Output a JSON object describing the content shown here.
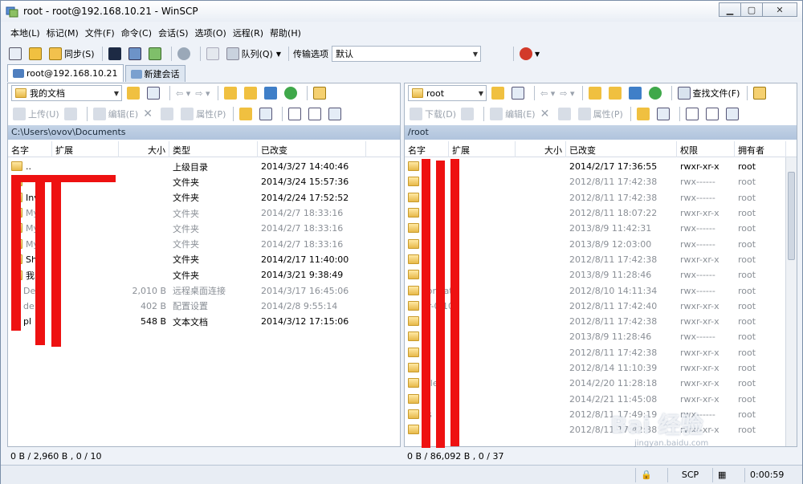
{
  "window": {
    "title": "root - root@192.168.10.21 - WinSCP",
    "buttons": {
      "min": "▁",
      "max": "▢",
      "close": "✕"
    }
  },
  "menu": [
    "本地(L)",
    "标记(M)",
    "文件(F)",
    "命令(C)",
    "会话(S)",
    "选项(O)",
    "远程(R)",
    "帮助(H)"
  ],
  "toolbar": {
    "sync_label": "同步(S)",
    "queue_label": "队列(Q)",
    "transfer_label": "传输选项",
    "transfer_value": "默认"
  },
  "tabs": [
    {
      "label": "root@192.168.10.21",
      "active": true
    },
    {
      "label": "新建会话",
      "active": false
    }
  ],
  "left": {
    "location": "我的文档",
    "actions": {
      "upload": "上传(U)",
      "edit": "编辑(E)",
      "props": "属性(P)"
    },
    "path": "C:\\Users\\ovov\\Documents",
    "columns": [
      "名字",
      "扩展",
      "大小",
      "类型",
      "已改变"
    ],
    "rows": [
      {
        "name": "..",
        "size": "",
        "type": "上级目录",
        "changed": "2014/3/27  14:40:46",
        "grey": false,
        "folder": true
      },
      {
        "name": "",
        "size": "",
        "type": "文件夹",
        "changed": "2014/3/24  15:57:36",
        "grey": false,
        "folder": true
      },
      {
        "name": "Inv",
        "size": "",
        "type": "文件夹",
        "changed": "2014/2/24  17:52:52",
        "grey": false,
        "folder": true
      },
      {
        "name": "My",
        "size": "",
        "type": "文件夹",
        "changed": "2014/2/7   18:33:16",
        "grey": true,
        "folder": true
      },
      {
        "name": "My",
        "size": "",
        "type": "文件夹",
        "changed": "2014/2/7   18:33:16",
        "grey": true,
        "folder": true
      },
      {
        "name": "My",
        "size": "",
        "type": "文件夹",
        "changed": "2014/2/7   18:33:16",
        "grey": true,
        "folder": true
      },
      {
        "name": "Shu",
        "size": "",
        "type": "文件夹",
        "changed": "2014/2/17  11:40:00",
        "grey": false,
        "folder": true
      },
      {
        "name": "我的",
        "size": "",
        "type": "文件夹",
        "changed": "2014/3/21   9:38:49",
        "grey": false,
        "folder": true
      },
      {
        "name": "De",
        "size": "2,010 B",
        "type": "远程桌面连接",
        "changed": "2014/3/17  16:45:06",
        "grey": true,
        "folder": false
      },
      {
        "name": "de",
        "size": "402 B",
        "type": "配置设置",
        "changed": "2014/2/8   9:55:14",
        "grey": true,
        "folder": false
      },
      {
        "name": "pl",
        "size": "548 B",
        "type": "文本文档",
        "changed": "2014/3/12  17:15:06",
        "grey": false,
        "folder": false
      }
    ],
    "status": "0 B / 2,960 B ,  0 / 10"
  },
  "right": {
    "location": "root",
    "actions": {
      "download": "下载(D)",
      "edit": "编辑(E)",
      "props": "属性(P)",
      "find": "查找文件(F)"
    },
    "path": "/root",
    "columns": [
      "名字",
      "扩展",
      "大小",
      "已改变",
      "权限",
      "拥有者"
    ],
    "rows": [
      {
        "name": "",
        "changed": "2014/2/17  17:36:55",
        "perm": "rwxr-xr-x",
        "owner": "root",
        "grey": false
      },
      {
        "name": "",
        "changed": "2012/8/11  17:42:38",
        "perm": "rwx------",
        "owner": "root",
        "grey": true
      },
      {
        "name": "",
        "changed": "2012/8/11  17:42:38",
        "perm": "rwx------",
        "owner": "root",
        "grey": true
      },
      {
        "name": "",
        "changed": "2012/8/11  18:07:22",
        "perm": "rwxr-xr-x",
        "owner": "root",
        "grey": true
      },
      {
        "name": "",
        "changed": "2013/8/9  11:42:31",
        "perm": "rwx------",
        "owner": "root",
        "grey": true
      },
      {
        "name": "",
        "changed": "2013/8/9  12:03:00",
        "perm": "rwx------",
        "owner": "root",
        "grey": true
      },
      {
        "name": "",
        "changed": "2012/8/11  17:42:38",
        "perm": "rwxr-xr-x",
        "owner": "root",
        "grey": true
      },
      {
        "name": "",
        "changed": "2013/8/9  11:28:46",
        "perm": "rwx------",
        "owner": "root",
        "grey": true
      },
      {
        "name": "_private",
        "changed": "2012/8/10  14:11:34",
        "perm": "rwx------",
        "owner": "root",
        "grey": true
      },
      {
        "name": "er-0.10",
        "changed": "2012/8/11  17:42:40",
        "perm": "rwxr-xr-x",
        "owner": "root",
        "grey": true
      },
      {
        "name": "",
        "changed": "2012/8/11  17:42:38",
        "perm": "rwxr-xr-x",
        "owner": "root",
        "grey": true
      },
      {
        "name": "",
        "changed": "2013/8/9  11:28:46",
        "perm": "rwx------",
        "owner": "root",
        "grey": true
      },
      {
        "name": "",
        "changed": "2012/8/11  17:42:38",
        "perm": "rwxr-xr-x",
        "owner": "root",
        "grey": true
      },
      {
        "name": "",
        "changed": "2012/8/14  11:10:39",
        "perm": "rwxr-xr-x",
        "owner": "root",
        "grey": true
      },
      {
        "name": "aller",
        "changed": "2014/2/20  11:28:18",
        "perm": "rwxr-xr-x",
        "owner": "root",
        "grey": true
      },
      {
        "name": "",
        "changed": "2014/2/21  11:45:08",
        "perm": "rwxr-xr-x",
        "owner": "root",
        "grey": true
      },
      {
        "name": "ils",
        "changed": "2012/8/11  17:49:19",
        "perm": "rwx------",
        "owner": "root",
        "grey": true
      },
      {
        "name": "",
        "changed": "2012/8/11  17:42:38",
        "perm": "rwxr-xr-x",
        "owner": "root",
        "grey": true
      }
    ],
    "status": "0 B / 86,092 B ,  0 / 37"
  },
  "statusbar": {
    "protocol": "SCP",
    "time": "0:00:59"
  },
  "watermark": {
    "brand": "Bai 经验",
    "url": "jingyan.baidu.com"
  },
  "colors": {
    "redact": "#ee1111",
    "pathbar": "#b8cae0"
  }
}
